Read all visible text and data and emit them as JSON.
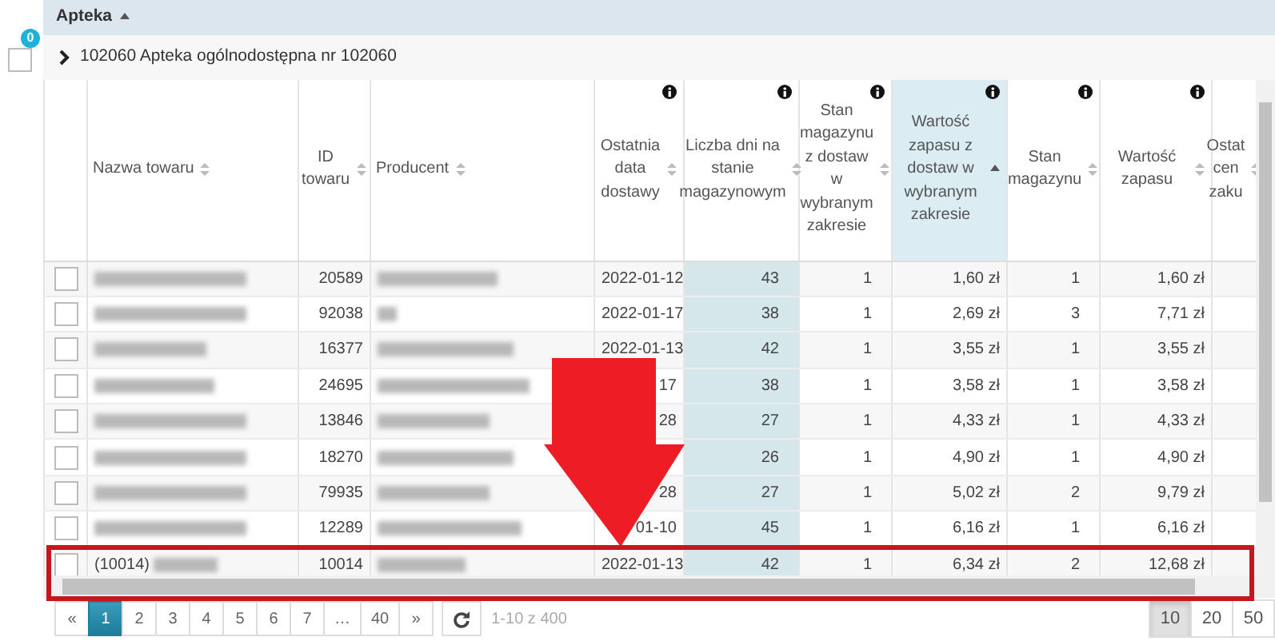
{
  "group_header": {
    "label": "Apteka",
    "sorted": true
  },
  "selection": {
    "checked": false,
    "badge": "0"
  },
  "group_row": {
    "expanded": false,
    "label": "102060 Apteka ogólnodostępna nr 102060"
  },
  "table": {
    "columns": [
      {
        "label": "Nazwa towaru",
        "kind": "text",
        "sorted": false,
        "info": false,
        "body_highlight": false
      },
      {
        "label": "ID towaru",
        "kind": "number",
        "sorted": false,
        "info": false,
        "body_highlight": false
      },
      {
        "label": "Producent",
        "kind": "text",
        "sorted": false,
        "info": false,
        "body_highlight": false
      },
      {
        "label": "Ostatnia data dostawy",
        "kind": "number",
        "sorted": false,
        "info": true,
        "body_highlight": false
      },
      {
        "label": "Liczba dni na stanie magazynowym",
        "kind": "number",
        "sorted": false,
        "info": true,
        "body_highlight": true
      },
      {
        "label": "Stan magazynu z dostaw w wybranym zakresie",
        "kind": "number",
        "sorted": false,
        "info": true,
        "body_highlight": false
      },
      {
        "label": "Wartość zapasu z dostaw w wybranym zakresie",
        "kind": "number",
        "sorted": true,
        "info": true,
        "body_highlight": false
      },
      {
        "label": "Stan magazynu",
        "kind": "number",
        "sorted": false,
        "info": true,
        "body_highlight": false
      },
      {
        "label": "Wartość zapasu",
        "kind": "number",
        "sorted": false,
        "info": true,
        "body_highlight": false
      },
      {
        "label": "Ostat cen zaku",
        "kind": "number",
        "sorted": false,
        "info": false,
        "body_highlight": false
      }
    ],
    "rows": [
      {
        "checked": false,
        "id": "20589",
        "date": "2022-01-12",
        "days": "43",
        "stock_range": "1",
        "value_range": "1,60 zł",
        "stock": "1",
        "value": "1,60 zł"
      },
      {
        "checked": false,
        "id": "92038",
        "date": "2022-01-17",
        "days": "38",
        "stock_range": "1",
        "value_range": "2,69 zł",
        "stock": "3",
        "value": "7,71 zł"
      },
      {
        "checked": false,
        "id": "16377",
        "date": "2022-01-13",
        "days": "42",
        "stock_range": "1",
        "value_range": "3,55 zł",
        "stock": "1",
        "value": "3,55 zł"
      },
      {
        "checked": false,
        "id": "24695",
        "date": "17",
        "days": "38",
        "stock_range": "1",
        "value_range": "3,58 zł",
        "stock": "1",
        "value": "3,58 zł"
      },
      {
        "checked": false,
        "id": "13846",
        "date": "28",
        "days": "27",
        "stock_range": "1",
        "value_range": "4,33 zł",
        "stock": "1",
        "value": "4,33 zł"
      },
      {
        "checked": false,
        "id": "18270",
        "days": "26",
        "stock_range": "1",
        "value_range": "4,90 zł",
        "stock": "1",
        "value": "4,90 zł"
      },
      {
        "checked": false,
        "id": "79935",
        "date": "28",
        "days": "27",
        "stock_range": "1",
        "value_range": "5,02 zł",
        "stock": "2",
        "value": "9,79 zł"
      },
      {
        "checked": false,
        "id": "12289",
        "date": "01-10",
        "days": "45",
        "stock_range": "1",
        "value_range": "6,16 zł",
        "stock": "1",
        "value": "6,16 zł"
      },
      {
        "checked": false,
        "name": "(10014)",
        "id": "10014",
        "date": "2022-01-13",
        "days": "42",
        "stock_range": "1",
        "value_range": "6,34 zł",
        "stock": "2",
        "value": "12,68 zł"
      }
    ]
  },
  "pagination": {
    "pages": [
      {
        "label": "«",
        "selected": false
      },
      {
        "label": "1",
        "selected": true
      },
      {
        "label": "2",
        "selected": false
      },
      {
        "label": "3",
        "selected": false
      },
      {
        "label": "4",
        "selected": false
      },
      {
        "label": "5",
        "selected": false
      },
      {
        "label": "6",
        "selected": false
      },
      {
        "label": "7",
        "selected": false
      },
      {
        "label": "…",
        "selected": false
      },
      {
        "label": "40",
        "selected": false
      },
      {
        "label": "»",
        "selected": false
      }
    ],
    "range": "1-10 z 400",
    "page_sizes": [
      {
        "label": "10",
        "selected": true
      },
      {
        "label": "20",
        "selected": false
      },
      {
        "label": "50",
        "selected": false
      }
    ]
  }
}
